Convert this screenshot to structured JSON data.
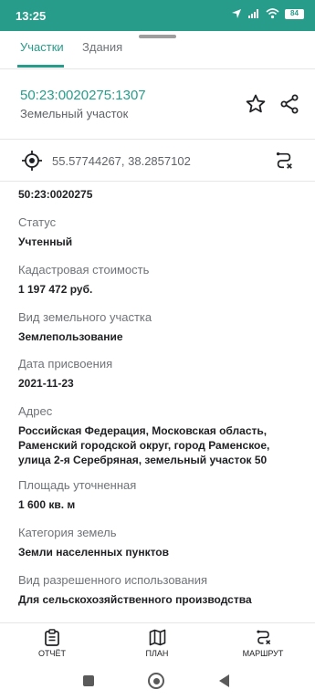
{
  "status_bar": {
    "time": "13:25",
    "battery": "84"
  },
  "tabs": [
    {
      "label": "Участки",
      "active": true
    },
    {
      "label": "Здания",
      "active": false
    }
  ],
  "object": {
    "cadastral_number": "50:23:0020275:1307",
    "type": "Земельный участок"
  },
  "coordinates": "55.57744267, 38.2857102",
  "details": {
    "quarter": "50:23:0020275",
    "fields": [
      {
        "label": "Статус",
        "value": "Учтенный"
      },
      {
        "label": "Кадастровая стоимость",
        "value": "1 197 472 руб."
      },
      {
        "label": "Вид земельного участка",
        "value": "Землепользование"
      },
      {
        "label": "Дата присвоения",
        "value": "2021-11-23"
      },
      {
        "label": "Адрес",
        "value": "Российская Федерация, Московская область, Раменский городской округ, город Раменское, улица 2-я Серебряная, земельный участок 50"
      },
      {
        "label": "Площадь уточненная",
        "value": "1 600 кв. м"
      },
      {
        "label": "Категория земель",
        "value": "Земли населенных пунктов"
      },
      {
        "label": "Вид разрешенного использования",
        "value": "Для сельскохозяйственного производства"
      }
    ]
  },
  "bottom_bar": {
    "report": "ОТЧЁТ",
    "plan": "ПЛАН",
    "route": "МАРШРУТ"
  },
  "colors": {
    "accent": "#279c8a",
    "status_bar": "#279c8a"
  }
}
